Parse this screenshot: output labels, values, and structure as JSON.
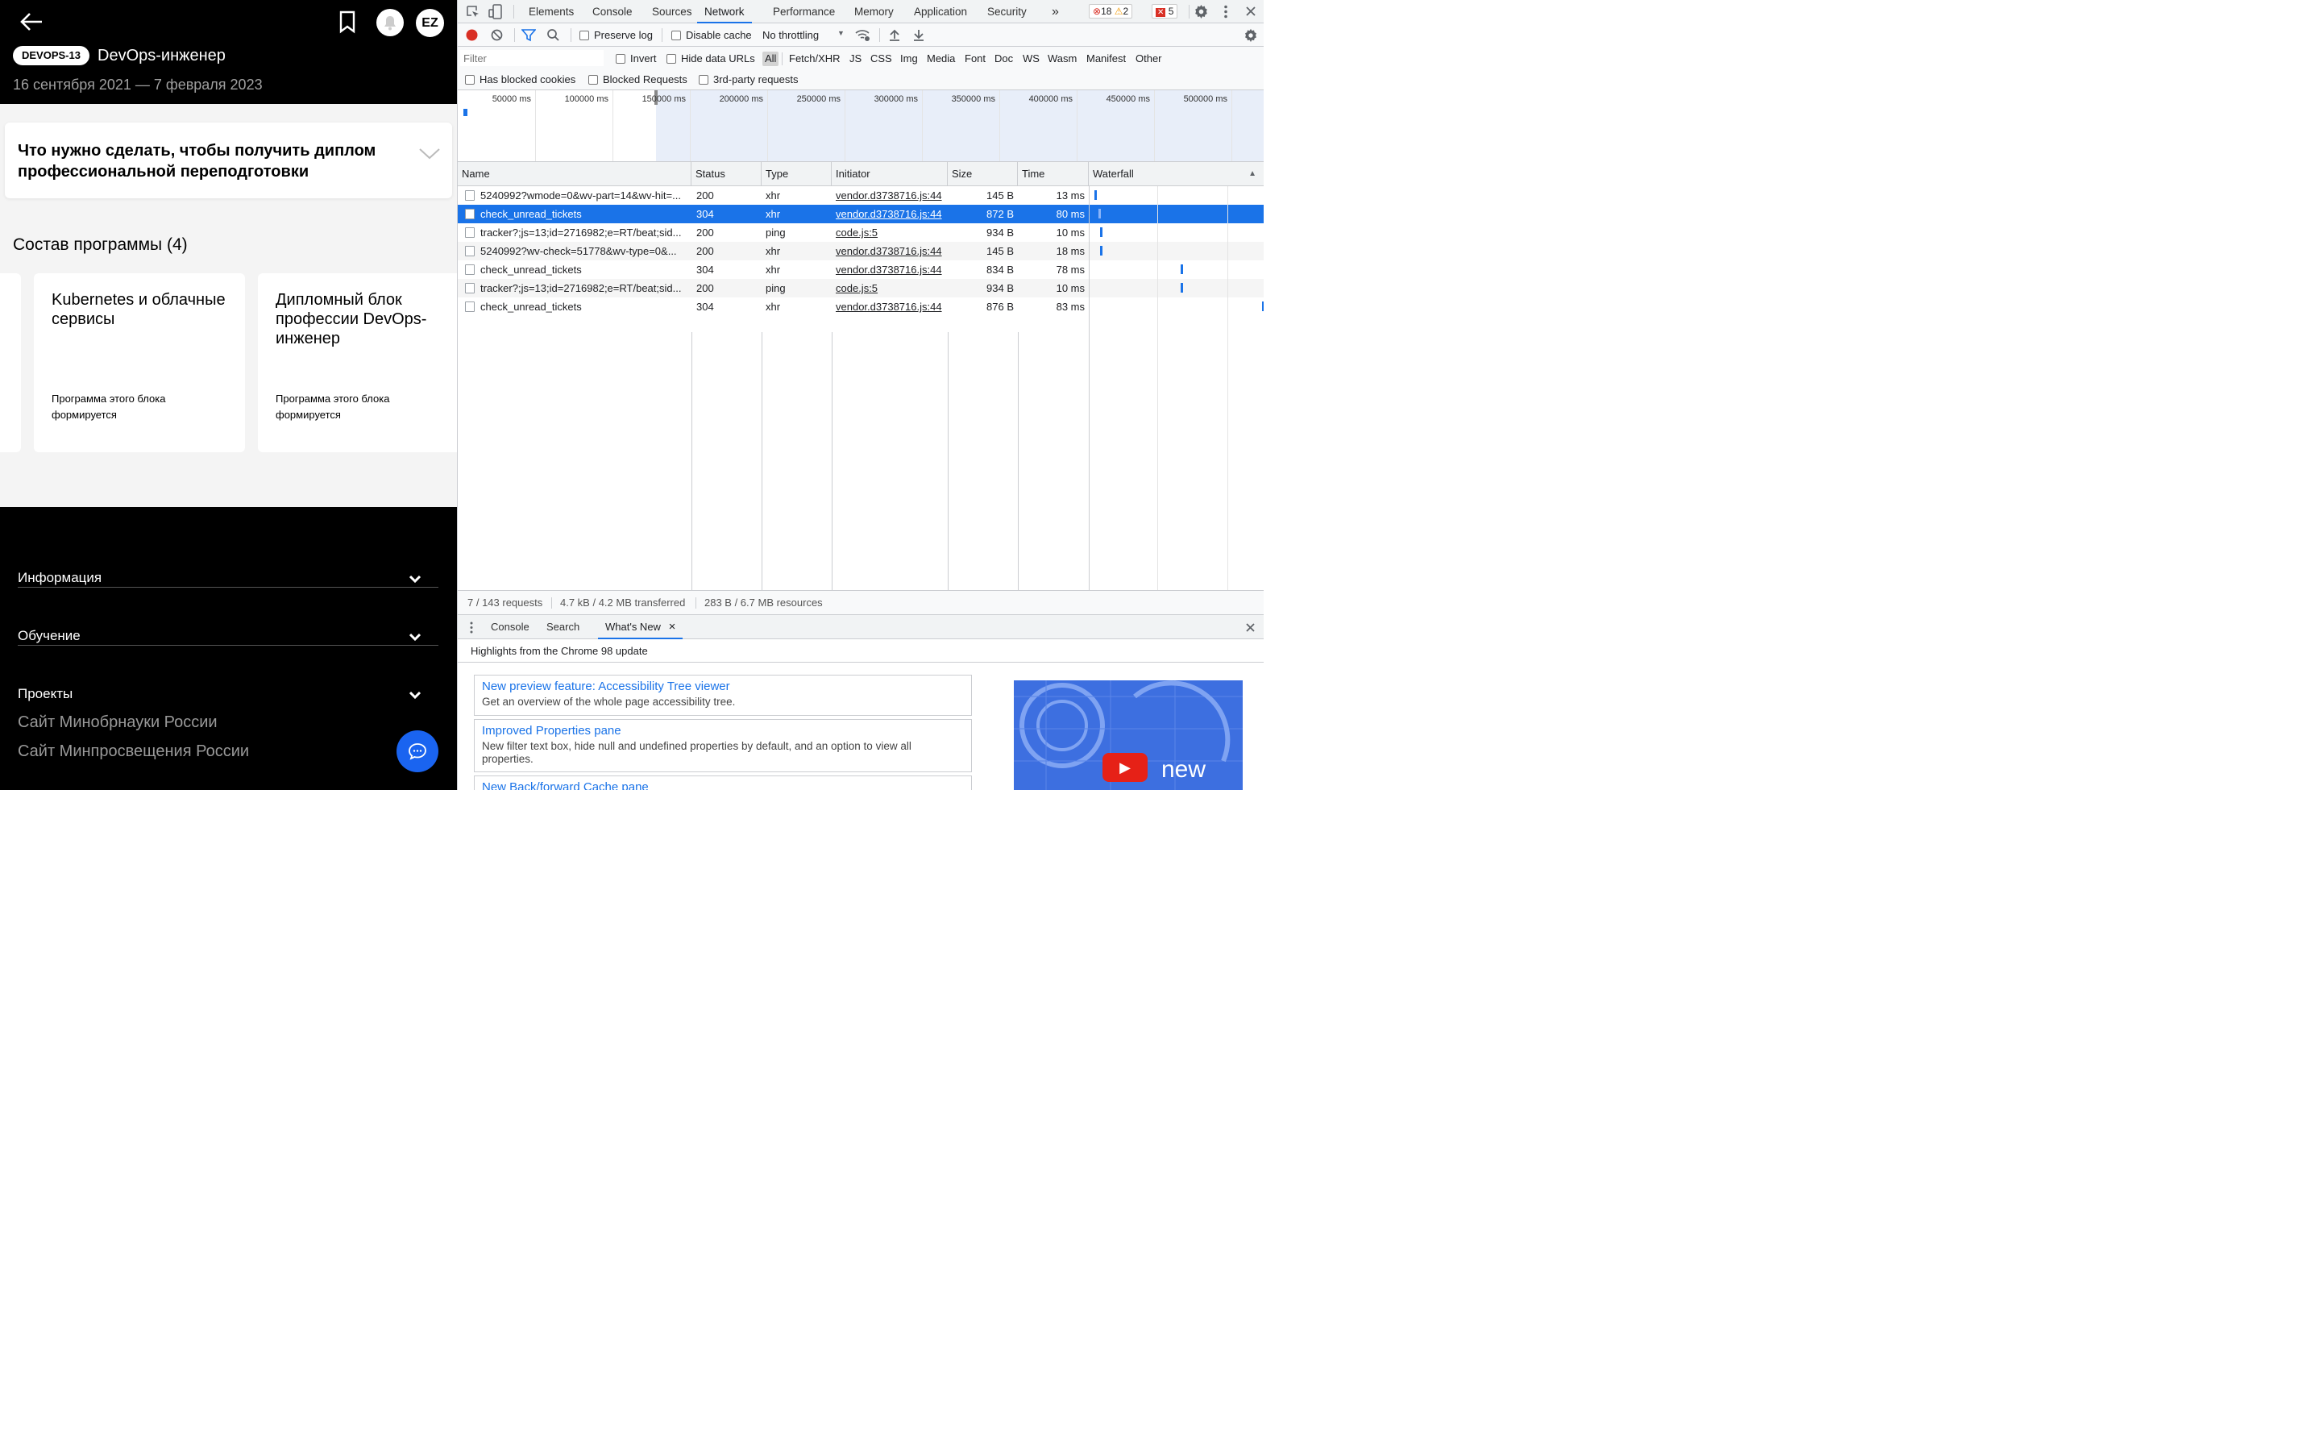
{
  "app": {
    "header": {
      "program_code": "DEVOPS-13",
      "program_title": "DevOps-инженер",
      "dates": "16 сентября 2021 — 7 февраля 2023",
      "avatar_initials": "EZ"
    },
    "accordion": {
      "title": "Что нужно сделать, чтобы получить диплом профессиональной переподготовки"
    },
    "program": {
      "section_title": "Состав программы (4)",
      "cards": [
        {
          "title": "Kubernetes и облачные сервисы",
          "subtitle": "Программа этого блока формируется"
        },
        {
          "title": "Дипломный блок профессии DevOps-инженер",
          "subtitle": "Программа этого блока формируется"
        }
      ]
    },
    "footer": {
      "items": [
        "Информация",
        "Обучение",
        "Проекты"
      ],
      "links": [
        "Сайт Минобрнауки России",
        "Сайт Минпросвещения России"
      ]
    }
  },
  "devtools": {
    "tabs": [
      "Elements",
      "Console",
      "Sources",
      "Network",
      "Performance",
      "Memory",
      "Application",
      "Security"
    ],
    "active_tab": "Network",
    "more": "»",
    "errors": "18",
    "warnings": "2",
    "issues": "5",
    "toolbar": {
      "preserve_log": "Preserve log",
      "disable_cache": "Disable cache",
      "throttling": "No throttling"
    },
    "filter": {
      "placeholder": "Filter",
      "invert": "Invert",
      "hide_data_urls": "Hide data URLs",
      "types": [
        "All",
        "Fetch/XHR",
        "JS",
        "CSS",
        "Img",
        "Media",
        "Font",
        "Doc",
        "WS",
        "Wasm",
        "Manifest",
        "Other"
      ],
      "selected_type": "All",
      "blocked_cookies": "Has blocked cookies",
      "blocked_requests": "Blocked Requests",
      "third_party": "3rd-party requests"
    },
    "overview_ticks": [
      "50000 ms",
      "100000 ms",
      "150000 ms",
      "200000 ms",
      "250000 ms",
      "300000 ms",
      "350000 ms",
      "400000 ms",
      "450000 ms",
      "500000 ms"
    ],
    "columns": [
      "Name",
      "Status",
      "Type",
      "Initiator",
      "Size",
      "Time",
      "Waterfall"
    ],
    "requests": [
      {
        "name": "5240992?wmode=0&wv-part=14&wv-hit=...",
        "status": "200",
        "type": "xhr",
        "initiator": "vendor.d3738716.js:44",
        "size": "145 B",
        "time": "13 ms"
      },
      {
        "name": "check_unread_tickets",
        "status": "304",
        "type": "xhr",
        "initiator": "vendor.d3738716.js:44",
        "size": "872 B",
        "time": "80 ms"
      },
      {
        "name": "tracker?;js=13;id=2716982;e=RT/beat;sid...",
        "status": "200",
        "type": "ping",
        "initiator": "code.js:5",
        "size": "934 B",
        "time": "10 ms"
      },
      {
        "name": "5240992?wv-check=51778&wv-type=0&...",
        "status": "200",
        "type": "xhr",
        "initiator": "vendor.d3738716.js:44",
        "size": "145 B",
        "time": "18 ms"
      },
      {
        "name": "check_unread_tickets",
        "status": "304",
        "type": "xhr",
        "initiator": "vendor.d3738716.js:44",
        "size": "834 B",
        "time": "78 ms"
      },
      {
        "name": "tracker?;js=13;id=2716982;e=RT/beat;sid...",
        "status": "200",
        "type": "ping",
        "initiator": "code.js:5",
        "size": "934 B",
        "time": "10 ms"
      },
      {
        "name": "check_unread_tickets",
        "status": "304",
        "type": "xhr",
        "initiator": "vendor.d3738716.js:44",
        "size": "876 B",
        "time": "83 ms"
      }
    ],
    "selected_row": 1,
    "summary": {
      "requests": "7 / 143 requests",
      "transferred": "4.7 kB / 4.2 MB transferred",
      "resources": "283 B / 6.7 MB resources"
    },
    "drawer": {
      "tabs": [
        "Console",
        "Search",
        "What's New"
      ],
      "active": "What's New",
      "close_tab": "×",
      "highlights": "Highlights from the Chrome 98 update",
      "items": [
        {
          "title": "New preview feature: Accessibility Tree viewer",
          "desc": "Get an overview of the whole page accessibility tree."
        },
        {
          "title": "Improved Properties pane",
          "desc": "New filter text box, hide null and undefined properties by default, and an option to view all properties."
        },
        {
          "title": "New Back/forward Cache pane",
          "desc": ""
        }
      ],
      "promo_text": "new"
    },
    "colors": {
      "accent": "#1a73e8",
      "error": "#d93025",
      "warning": "#f29900"
    }
  }
}
